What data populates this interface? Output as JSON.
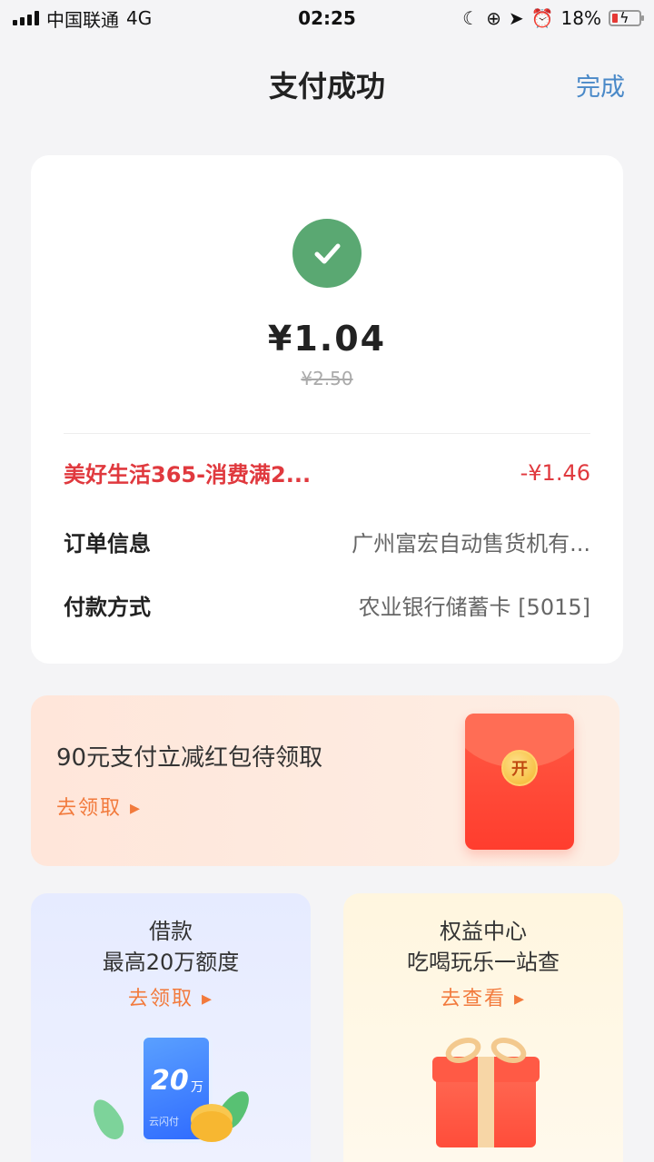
{
  "status_bar": {
    "carrier": "中国联通",
    "network": "4G",
    "time": "02:25",
    "battery": "18%"
  },
  "nav": {
    "title": "支付成功",
    "done_label": "完成"
  },
  "payment": {
    "amount": "¥1.04",
    "original_amount": "¥2.50",
    "discount": {
      "label": "美好生活365-消费满2...",
      "value": "-¥1.46"
    },
    "order_info": {
      "label": "订单信息",
      "value": "广州富宏自动售货机有..."
    },
    "payment_method": {
      "label": "付款方式",
      "value": "农业银行储蓄卡 [5015]"
    },
    "success_color": "#5aa872"
  },
  "promo": {
    "title": "90元支付立减红包待领取",
    "link": "去领取 ▸",
    "packet_char": "开"
  },
  "tiles": {
    "loan": {
      "title": "借款",
      "subtitle": "最高20万额度",
      "link": "去领取 ▸",
      "phone_amount": "20",
      "phone_unit": "万",
      "phone_brand": "云闪付"
    },
    "perks": {
      "title": "权益中心",
      "subtitle": "吃喝玩乐一站查",
      "link": "去查看 ▸"
    }
  }
}
